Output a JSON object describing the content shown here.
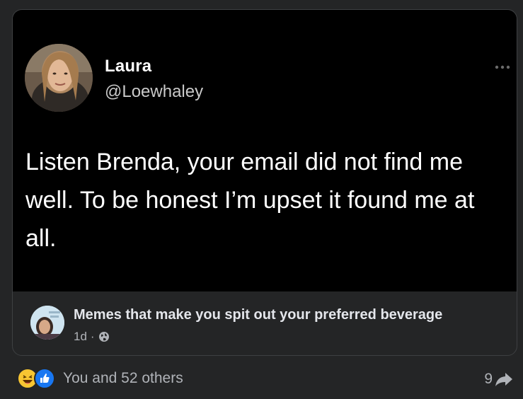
{
  "tweet": {
    "author_name": "Laura",
    "author_handle": "@Loewhaley",
    "text": "Listen Brenda, your email did not find me well. To be honest I’m upset it found me at all."
  },
  "post": {
    "group_name": "Memes that make you spit out your preferred beverage",
    "time": "1d",
    "separator": "·",
    "privacy_icon": "globe-icon"
  },
  "footer": {
    "reaction_icons": [
      "haha-icon",
      "like-icon"
    ],
    "reaction_text": "You and 52 others",
    "share_count": "9",
    "share_icon": "share-arrow-icon"
  },
  "colors": {
    "background": "#242526",
    "tweet_background": "#000000",
    "text_primary": "#e4e6eb",
    "text_secondary": "#b0b3b8",
    "like_blue": "#1877f2",
    "haha_yellow": "#f7c532"
  }
}
